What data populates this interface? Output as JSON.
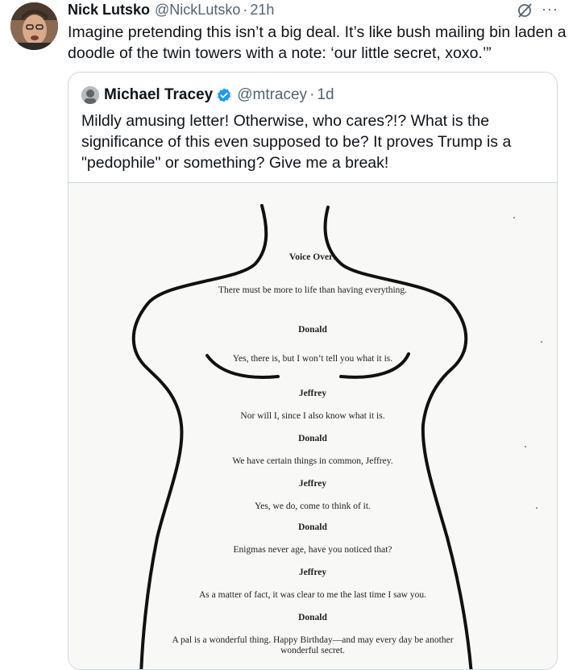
{
  "tweet": {
    "author_name": "Nick Lutsko",
    "author_handle": "@NickLutsko",
    "separator": "·",
    "time": "21h",
    "text": "Imagine pretending this isn’t a big deal. It’s like bush mailing bin laden a doodle of the twin towers with a note: ‘our little secret, xoxo.’”",
    "icons": [
      "grok-icon",
      "more-icon"
    ]
  },
  "quote": {
    "author_name": "Michael Tracey",
    "author_handle": "@mtracey",
    "separator": "·",
    "time": "1d",
    "verified": true,
    "text": "Mildly amusing letter! Otherwise, who cares?!? What is the significance of this even supposed to be? It proves Trump is a \"pedophile\" or something? Give me a break!",
    "image_letter": [
      {
        "text": "Voice Over:",
        "bold": true
      },
      {
        "text": "There must be more to life than having everything.",
        "bold": false
      },
      {
        "text": "Donald",
        "bold": true
      },
      {
        "text": "Yes, there is, but I won’t tell you what it is.",
        "bold": false
      },
      {
        "text": "Jeffrey",
        "bold": true
      },
      {
        "text": "Nor will I, since I also know what it is.",
        "bold": false
      },
      {
        "text": "Donald",
        "bold": true
      },
      {
        "text": "We have certain things in common, Jeffrey.",
        "bold": false
      },
      {
        "text": "Jeffrey",
        "bold": true
      },
      {
        "text": "Yes, we do, come to think of it.",
        "bold": false
      },
      {
        "text": "Donald",
        "bold": true
      },
      {
        "text": "Enigmas never age, have you noticed that?",
        "bold": false
      },
      {
        "text": "Jeffrey",
        "bold": true
      },
      {
        "text": "As a matter of fact, it was clear to me the last time I saw you.",
        "bold": false
      },
      {
        "text": "Donald",
        "bold": true
      },
      {
        "text": "A pal is a wonderful thing. Happy Birthday—and may every day be another",
        "bold": false
      },
      {
        "text": "wonderful secret.",
        "bold": false
      }
    ]
  },
  "colors": {
    "text_primary": "#0f1419",
    "text_secondary": "#536471",
    "border": "#cfd9de",
    "verified_blue": "#1d9bf0"
  }
}
